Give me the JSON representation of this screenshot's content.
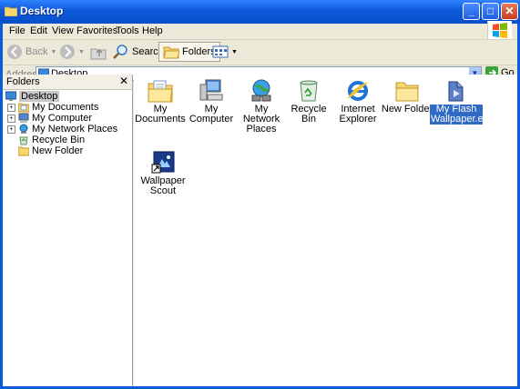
{
  "window": {
    "title": "Desktop",
    "min_label": "_",
    "max_label": "□",
    "close_label": "✕"
  },
  "menu": [
    "File",
    "Edit",
    "View",
    "Favorites",
    "Tools",
    "Help"
  ],
  "toolbar": {
    "back": "Back",
    "search": "Search",
    "folders": "Folders"
  },
  "address": {
    "label": "Address",
    "value": "Desktop",
    "go": "Go"
  },
  "folders_panel": {
    "title": "Folders",
    "close": "✕",
    "items": [
      {
        "label": "Desktop",
        "selected": true
      },
      {
        "label": "My Documents",
        "expander": "+"
      },
      {
        "label": "My Computer",
        "expander": "+"
      },
      {
        "label": "My Network Places",
        "expander": "+"
      },
      {
        "label": "Recycle Bin"
      },
      {
        "label": "New Folder"
      }
    ]
  },
  "desktop_icons": [
    {
      "label": "My Documents",
      "icon": "my-documents-icon"
    },
    {
      "label": "My Computer",
      "icon": "my-computer-icon"
    },
    {
      "label": "My Network Places",
      "icon": "network-places-icon"
    },
    {
      "label": "Recycle Bin",
      "icon": "recycle-bin-icon"
    },
    {
      "label": "Internet Explorer",
      "icon": "internet-explorer-icon"
    },
    {
      "label": "New Folder",
      "icon": "folder-icon"
    },
    {
      "label": "My Flash Wallpaper.exe",
      "icon": "flash-wallpaper-icon",
      "selected": true
    },
    {
      "label": "Wallpaper Scout",
      "icon": "wallpaper-scout-shortcut-icon"
    }
  ]
}
